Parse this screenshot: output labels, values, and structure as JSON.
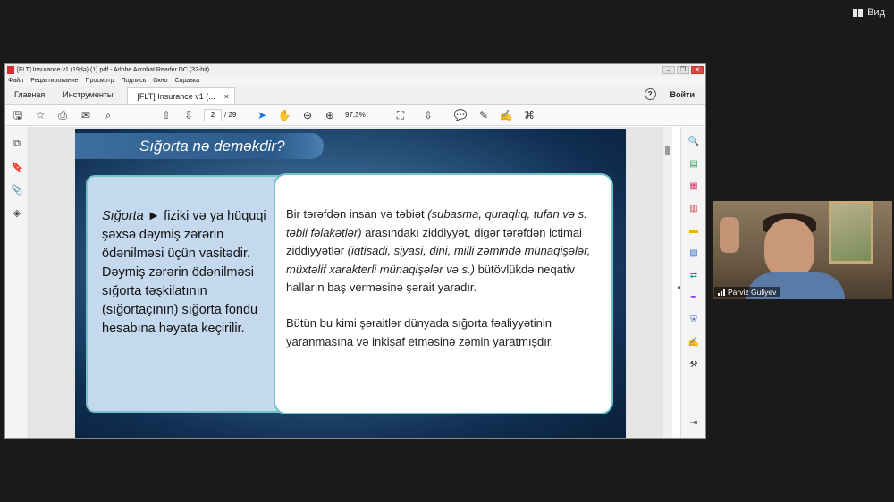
{
  "meeting": {
    "view_label": "Вид"
  },
  "window": {
    "title": "[FLT] Insurance v1 (19də) (1).pdf - Adobe Acrobat Reader DC (32-bit)",
    "menu": [
      "Файл",
      "Редактирование",
      "Просмотр",
      "Подпись",
      "Окно",
      "Справка"
    ],
    "tabs": {
      "home": "Главная",
      "tools": "Инструменты",
      "doc": "[FLT] Insurance v1 (..."
    },
    "signin": "Войти",
    "help_symbol": "?"
  },
  "toolbar": {
    "page_current": "2",
    "page_total": "/ 29",
    "zoom": "97,3%"
  },
  "slide": {
    "title": "Sığorta nə deməkdir?",
    "left_term": "Sığorta ►",
    "left_text": " fiziki və ya hüquqi şəxsə dəymiş zərərin ödənilməsi üçün vasitədir. Dəymiş zərərin ödənilməsi sığorta təşkilatının (sığortaçının) sığorta fondu hesabına həyata keçirilir.",
    "right_p1_a": "Bir tərəfdən insan və təbiət ",
    "right_p1_b": "(subasma, quraqlıq, tufan və s. təbii fəlakətlər)",
    "right_p1_c": " arasındakı ziddiyyət, digər tərəfdən ictimai ziddiyyətlər ",
    "right_p1_d": "(iqtisadi, siyasi, dini, milli zəmində münaqişələr, müxtəlif xarakterli münaqişələr və s.)",
    "right_p1_e": " bütövlükdə neqativ halların baş verməsinə şərait yaradır.",
    "right_p2": "Bütün bu kimi şəraitlər dünyada sığorta fəaliyyətinin yaranmasına və inkişaf etməsinə zəmin yaratmışdır."
  },
  "participant": {
    "name": "Parviz Guliyev"
  }
}
